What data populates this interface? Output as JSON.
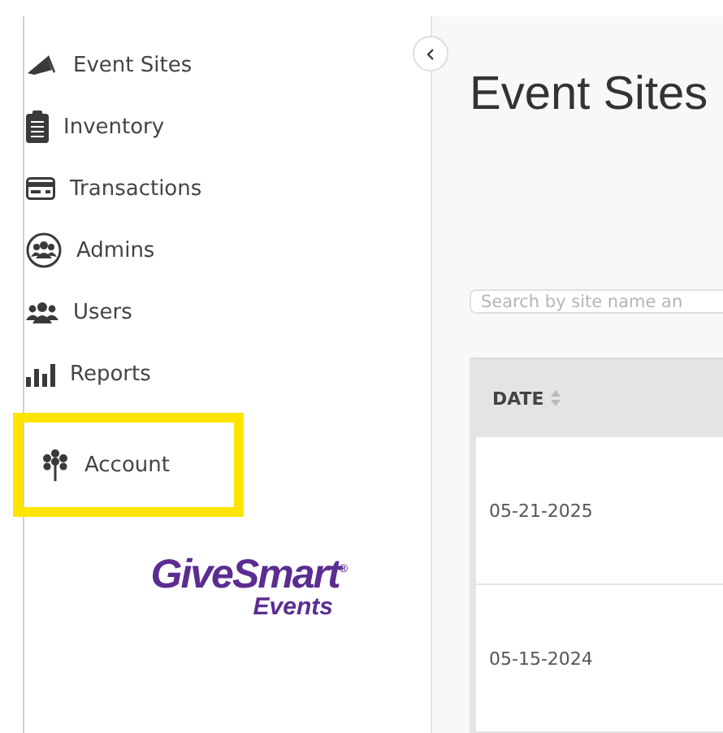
{
  "sidebar": {
    "items": [
      {
        "label": "Event Sites",
        "kind": "megaphone",
        "highlighted": false
      },
      {
        "label": "Inventory",
        "kind": "clipboard",
        "highlighted": false
      },
      {
        "label": "Transactions",
        "kind": "card",
        "highlighted": false
      },
      {
        "label": "Admins",
        "kind": "group",
        "highlighted": false
      },
      {
        "label": "Users",
        "kind": "users",
        "highlighted": false
      },
      {
        "label": "Reports",
        "kind": "chart",
        "highlighted": false
      },
      {
        "label": "Account",
        "kind": "tree",
        "highlighted": true
      }
    ],
    "logo": {
      "name": "GiveSmart$^{®}$",
      "sub": "Events"
    }
  },
  "page": {
    "title": "Event Sites"
  },
  "search": {
    "placeholder": "Search by site name an"
  },
  "table": {
    "columns": [
      {
        "label": "DATE",
        "sortable": true
      }
    ],
    "rows": [
      [
        "05-21-2025"
      ],
      [
        "05-15-2024"
      ]
    ]
  }
}
